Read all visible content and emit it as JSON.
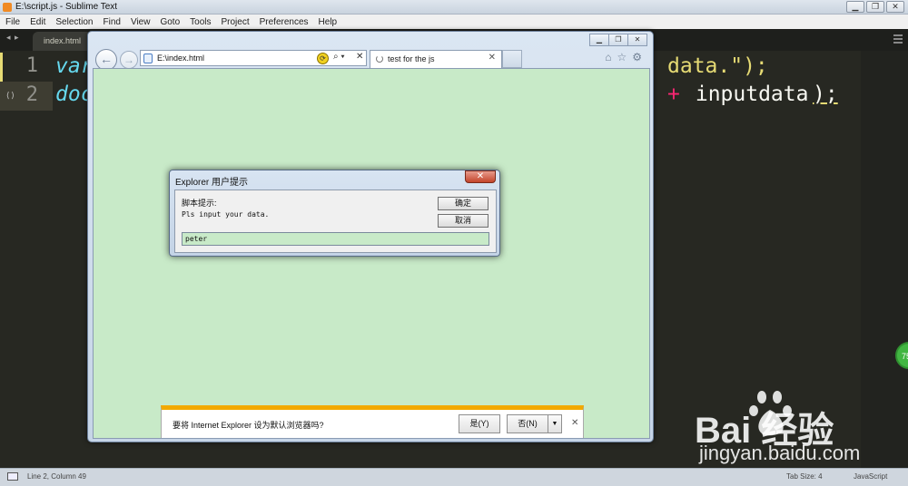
{
  "sublime": {
    "window_title": "E:\\script.js - Sublime Text",
    "menu": [
      "File",
      "Edit",
      "Selection",
      "Find",
      "View",
      "Goto",
      "Tools",
      "Project",
      "Preferences",
      "Help"
    ],
    "tab_nav": "◂ ▸",
    "tab_label": "index.html",
    "lines": [
      {
        "num": "1",
        "kw": "var",
        "tail_str": "data.\");"
      },
      {
        "num": "2",
        "kw": "doc",
        "tail_op": "+",
        "tail_id": " inputdata",
        "tail_end": ");"
      }
    ],
    "fold_mark": "⟨⟩",
    "status_left": "Line 2, Column 49",
    "status_tab": "Tab Size: 4",
    "status_syntax": "JavaScript"
  },
  "ie": {
    "address": "E:\\index.html",
    "tab_title": "test for the js",
    "notification": {
      "message": "要将 Internet Explorer 设为默认浏览器吗?",
      "yes": "是(Y)",
      "no": "否(N)"
    },
    "dialog": {
      "title": "Explorer 用户提示",
      "prompt_label": "脚本提示:",
      "prompt_message": "Pls input your data.",
      "ok": "确定",
      "cancel": "取消",
      "input_value": "peter"
    }
  },
  "watermark": {
    "brand_text": "Bai  经验",
    "url": "jingyan.baidu.com"
  },
  "colors": {
    "editor_bg": "#272822",
    "page_bg": "#c8eac8",
    "notif_accent": "#f2a900"
  }
}
